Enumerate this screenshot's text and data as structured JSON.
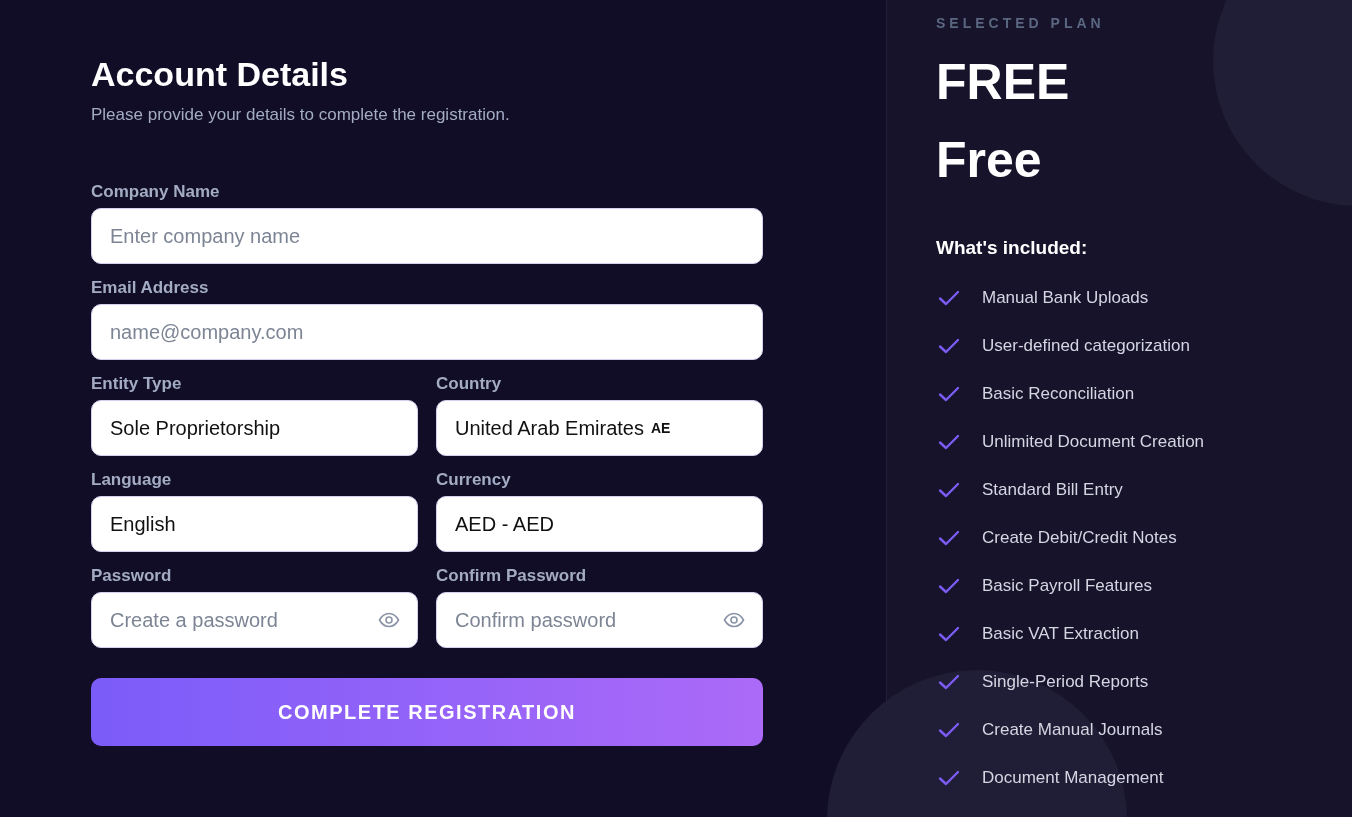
{
  "form": {
    "title": "Account Details",
    "subtitle": "Please provide your details to complete the registration.",
    "rows": [
      [
        {
          "kind": "text",
          "label": "Company Name",
          "placeholder": "Enter company name"
        }
      ],
      [
        {
          "kind": "text",
          "label": "Email Address",
          "placeholder": "name@company.com"
        }
      ],
      [
        {
          "kind": "select",
          "label": "Entity Type",
          "value": "Sole Proprietorship"
        },
        {
          "kind": "select",
          "label": "Country",
          "value": "United Arab Emirates",
          "code": "AE"
        }
      ],
      [
        {
          "kind": "select",
          "label": "Language",
          "value": "English"
        },
        {
          "kind": "select",
          "label": "Currency",
          "value": "AED - AED"
        }
      ],
      [
        {
          "kind": "password",
          "label": "Password",
          "placeholder": "Create a password"
        },
        {
          "kind": "password",
          "label": "Confirm Password",
          "placeholder": "Confirm password"
        }
      ]
    ],
    "submit": "COMPLETE REGISTRATION"
  },
  "plan": {
    "eyebrow": "SELECTED PLAN",
    "name": "FREE",
    "price": "Free",
    "features_title": "What's included:",
    "features": [
      "Manual Bank Uploads",
      "User-defined categorization",
      "Basic Reconciliation",
      "Unlimited Document Creation",
      "Standard Bill Entry",
      "Create Debit/Credit Notes",
      "Basic Payroll Features",
      "Basic VAT Extraction",
      "Single-Period Reports",
      "Create Manual Journals",
      "Document Management"
    ]
  }
}
